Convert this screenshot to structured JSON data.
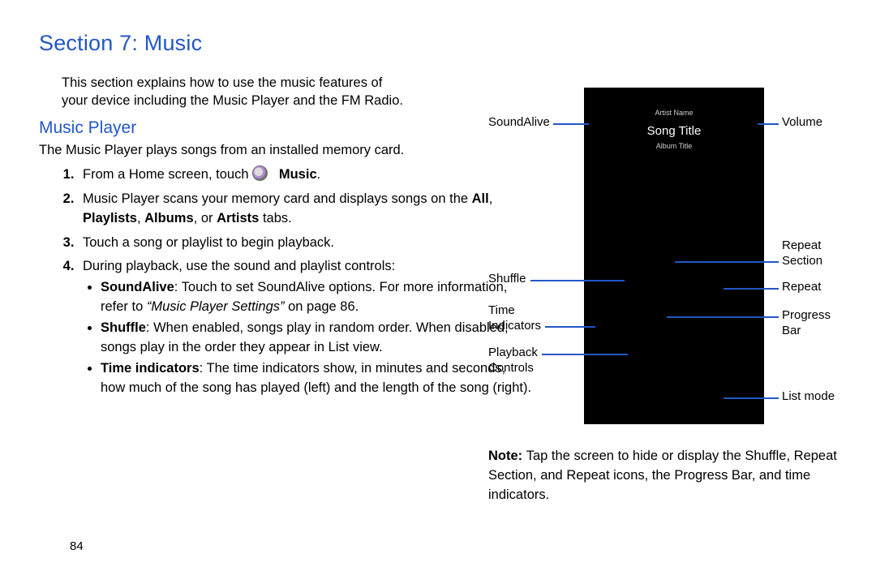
{
  "page_number": "84",
  "section_title": "Section 7: Music",
  "intro": "This section explains how to use the music features of your device including the Music Player and the FM Radio.",
  "subhead": "Music Player",
  "mp_desc": "The Music Player plays songs from an installed memory card.",
  "steps": {
    "s1a": "From a Home screen, touch ",
    "s1b": "Music",
    "s1c": ".",
    "s2a": "Music Player scans your memory card and displays songs on the ",
    "s2_all": "All",
    "s2_comma1": ", ",
    "s2_pl": "Playlists",
    "s2_comma2": ", ",
    "s2_al": "Albums",
    "s2_comma3": ", or ",
    "s2_ar": "Artists",
    "s2_tabs": " tabs.",
    "s3": "Touch a song or playlist to begin playback.",
    "s4": "During playback, use the sound and playlist controls:",
    "b1_head": "SoundAlive",
    "b1_body1": ": Touch to set SoundAlive options. For more information, refer to ",
    "b1_ital": "“Music Player Settings” ",
    "b1_body2": " on page 86.",
    "b2_head": "Shuffle",
    "b2_body": ": When enabled, songs play in random order. When disabled, songs play in the order they appear in List view.",
    "b3_head": "Time indicators",
    "b3_body": ": The time indicators show, in minutes and seconds, how much of the song has played (left) and the length of the song (right)."
  },
  "figure": {
    "artist": "Artist Name",
    "song": "Song Title",
    "album": "Album Title",
    "l_soundalive": "SoundAlive",
    "l_shuffle": "Shuffle",
    "l_time": "Time\nIndicators",
    "l_playback": "Playback\nControls",
    "r_volume": "Volume",
    "r_repeat_section": "Repeat\nSection",
    "r_repeat": "Repeat",
    "r_progress": "Progress\nBar",
    "r_list": "List mode"
  },
  "note_head": "Note: ",
  "note_body": "Tap the screen to hide or display the Shuffle, Repeat Section, and Repeat icons, the Progress Bar, and time indicators."
}
